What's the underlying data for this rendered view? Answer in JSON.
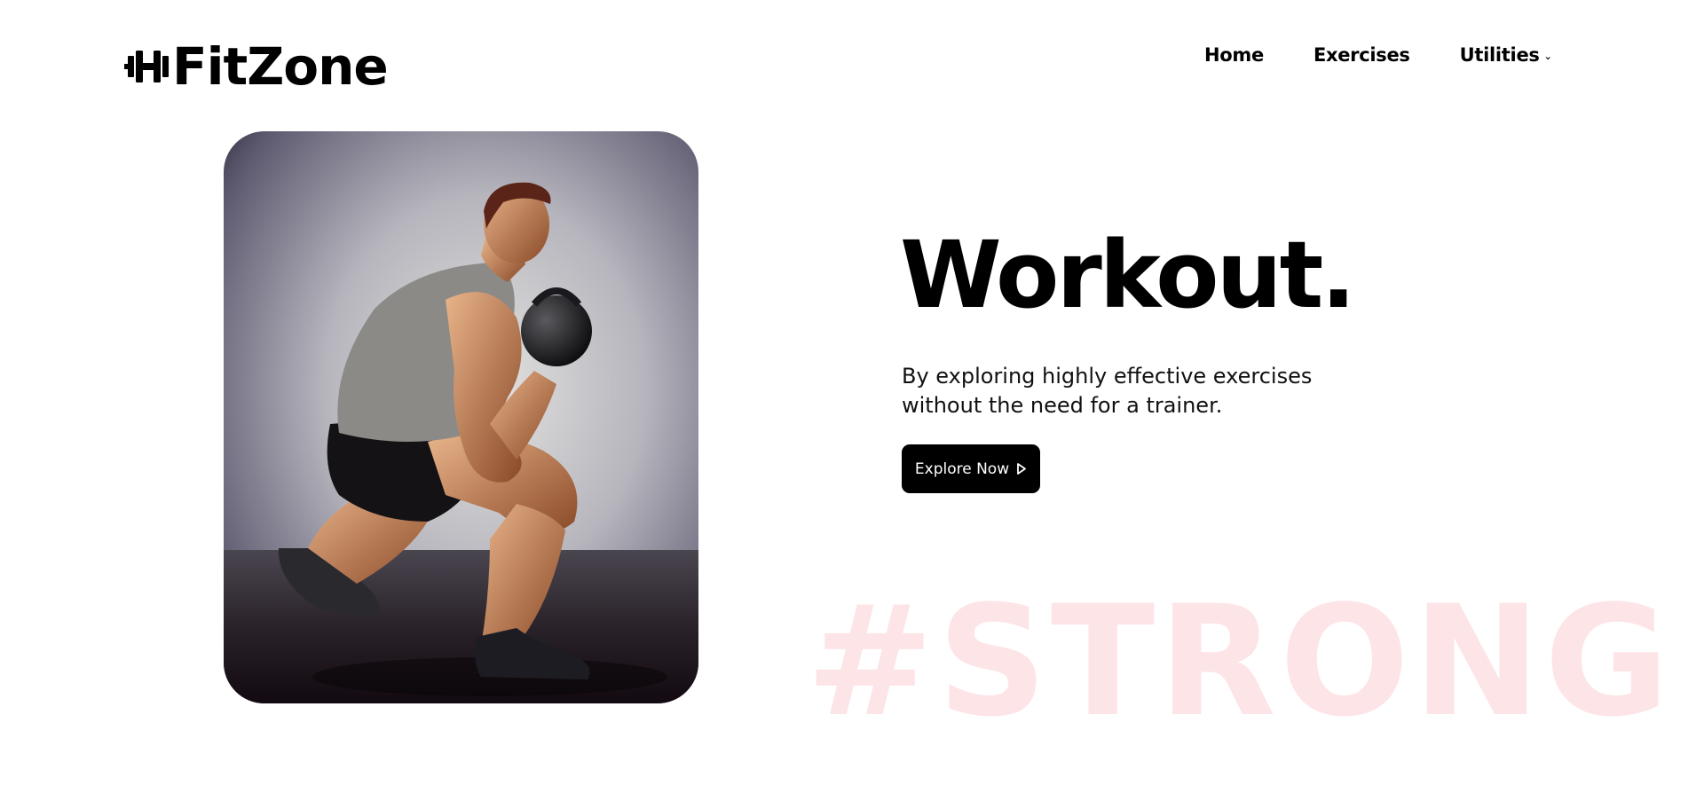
{
  "brand": {
    "name": "FitZone",
    "icon": "dumbbell-icon"
  },
  "nav": {
    "items": [
      {
        "label": "Home"
      },
      {
        "label": "Exercises"
      },
      {
        "label": "Utilities",
        "icon": "chevron-down-icon"
      }
    ]
  },
  "hero": {
    "headline": "Workout.",
    "subtitle": "By exploring highly effective exercises without the need for a trainer.",
    "cta_label": "Explore Now",
    "cta_icon": "play-outline-icon",
    "watermark": "#STRONG",
    "image_subject": "man squatting holding a kettlebell"
  },
  "colors": {
    "text": "#000000",
    "button_bg": "#000000",
    "button_text": "#ffffff",
    "watermark": "#fde4e6",
    "background": "#ffffff"
  }
}
